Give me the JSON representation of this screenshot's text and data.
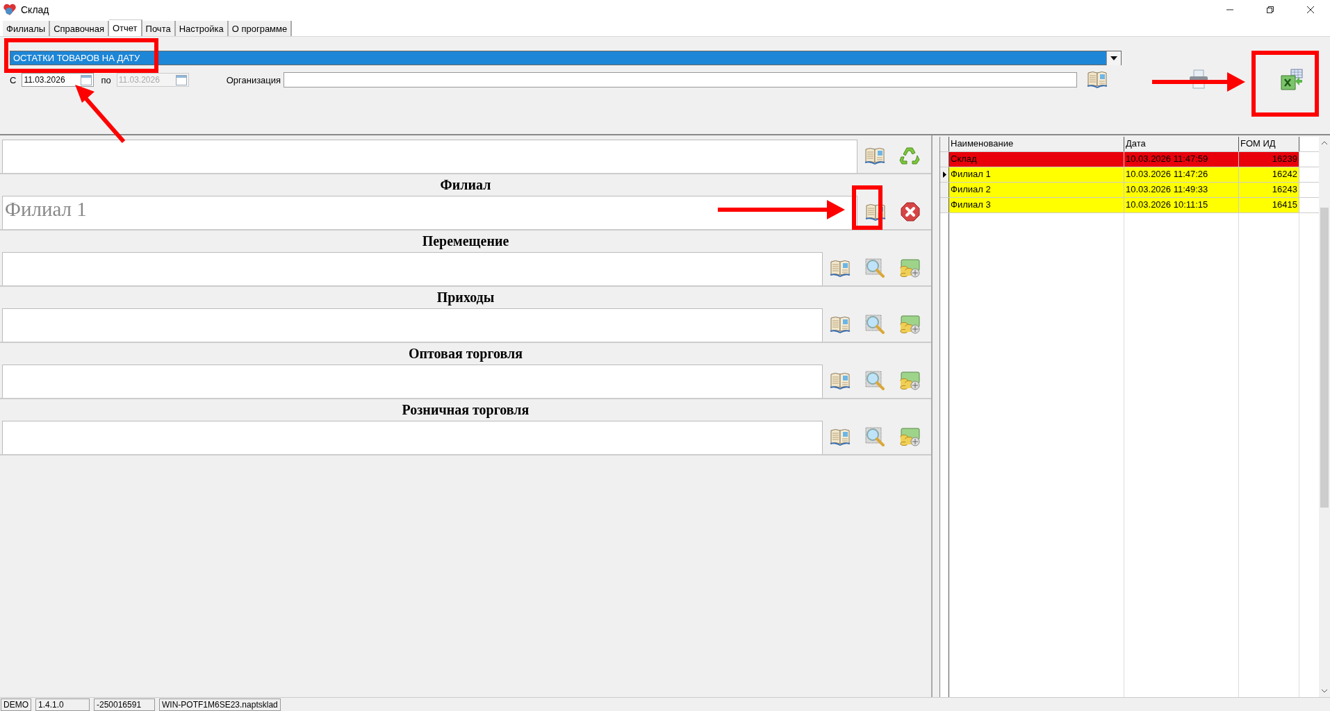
{
  "window": {
    "title": "Склад"
  },
  "tabs": [
    {
      "label": "Филиалы",
      "selected": false
    },
    {
      "label": "Справочная",
      "selected": false
    },
    {
      "label": "Отчет",
      "selected": true
    },
    {
      "label": "Почта",
      "selected": false
    },
    {
      "label": "Настройка",
      "selected": false
    },
    {
      "label": "О программе",
      "selected": false
    }
  ],
  "report_type": {
    "value": "ОСТАТКИ ТОВАРОВ НА ДАТУ"
  },
  "date_from": {
    "label": "С",
    "value": "11.03.2026",
    "disabled": false
  },
  "date_to": {
    "label": "по",
    "value": "11.03.2026",
    "disabled": true
  },
  "organization": {
    "label": "Организация"
  },
  "sections": [
    {
      "kind": "filter"
    },
    {
      "kind": "branch",
      "title": "Филиал",
      "value": "Филиал 1"
    },
    {
      "kind": "document",
      "title": "Перемещение"
    },
    {
      "kind": "document",
      "title": "Приходы"
    },
    {
      "kind": "document",
      "title": "Оптовая торговля"
    },
    {
      "kind": "document",
      "title": "Розничная торговля"
    }
  ],
  "table": {
    "columns": [
      "Наименование",
      "Дата",
      "FOM ИД"
    ],
    "rows": [
      {
        "cells": [
          "Склад",
          "10.03.2026 11:47:59",
          "16239"
        ],
        "color": "#e8000b",
        "selected": false
      },
      {
        "cells": [
          "Филиал 1",
          "10.03.2026 11:47:26",
          "16242"
        ],
        "color": "#ffff00",
        "selected": true
      },
      {
        "cells": [
          "Филиал 2",
          "10.03.2026 11:49:33",
          "16243"
        ],
        "color": "#ffff00",
        "selected": false
      },
      {
        "cells": [
          "Филиал 3",
          "10.03.2026 10:11:15",
          "16415"
        ],
        "color": "#ffff00",
        "selected": false
      }
    ]
  },
  "status_bar": [
    "DEMO",
    "1.4.1.0",
    "-250016591",
    "WIN-POTF1M6SE23.naptsklad"
  ]
}
